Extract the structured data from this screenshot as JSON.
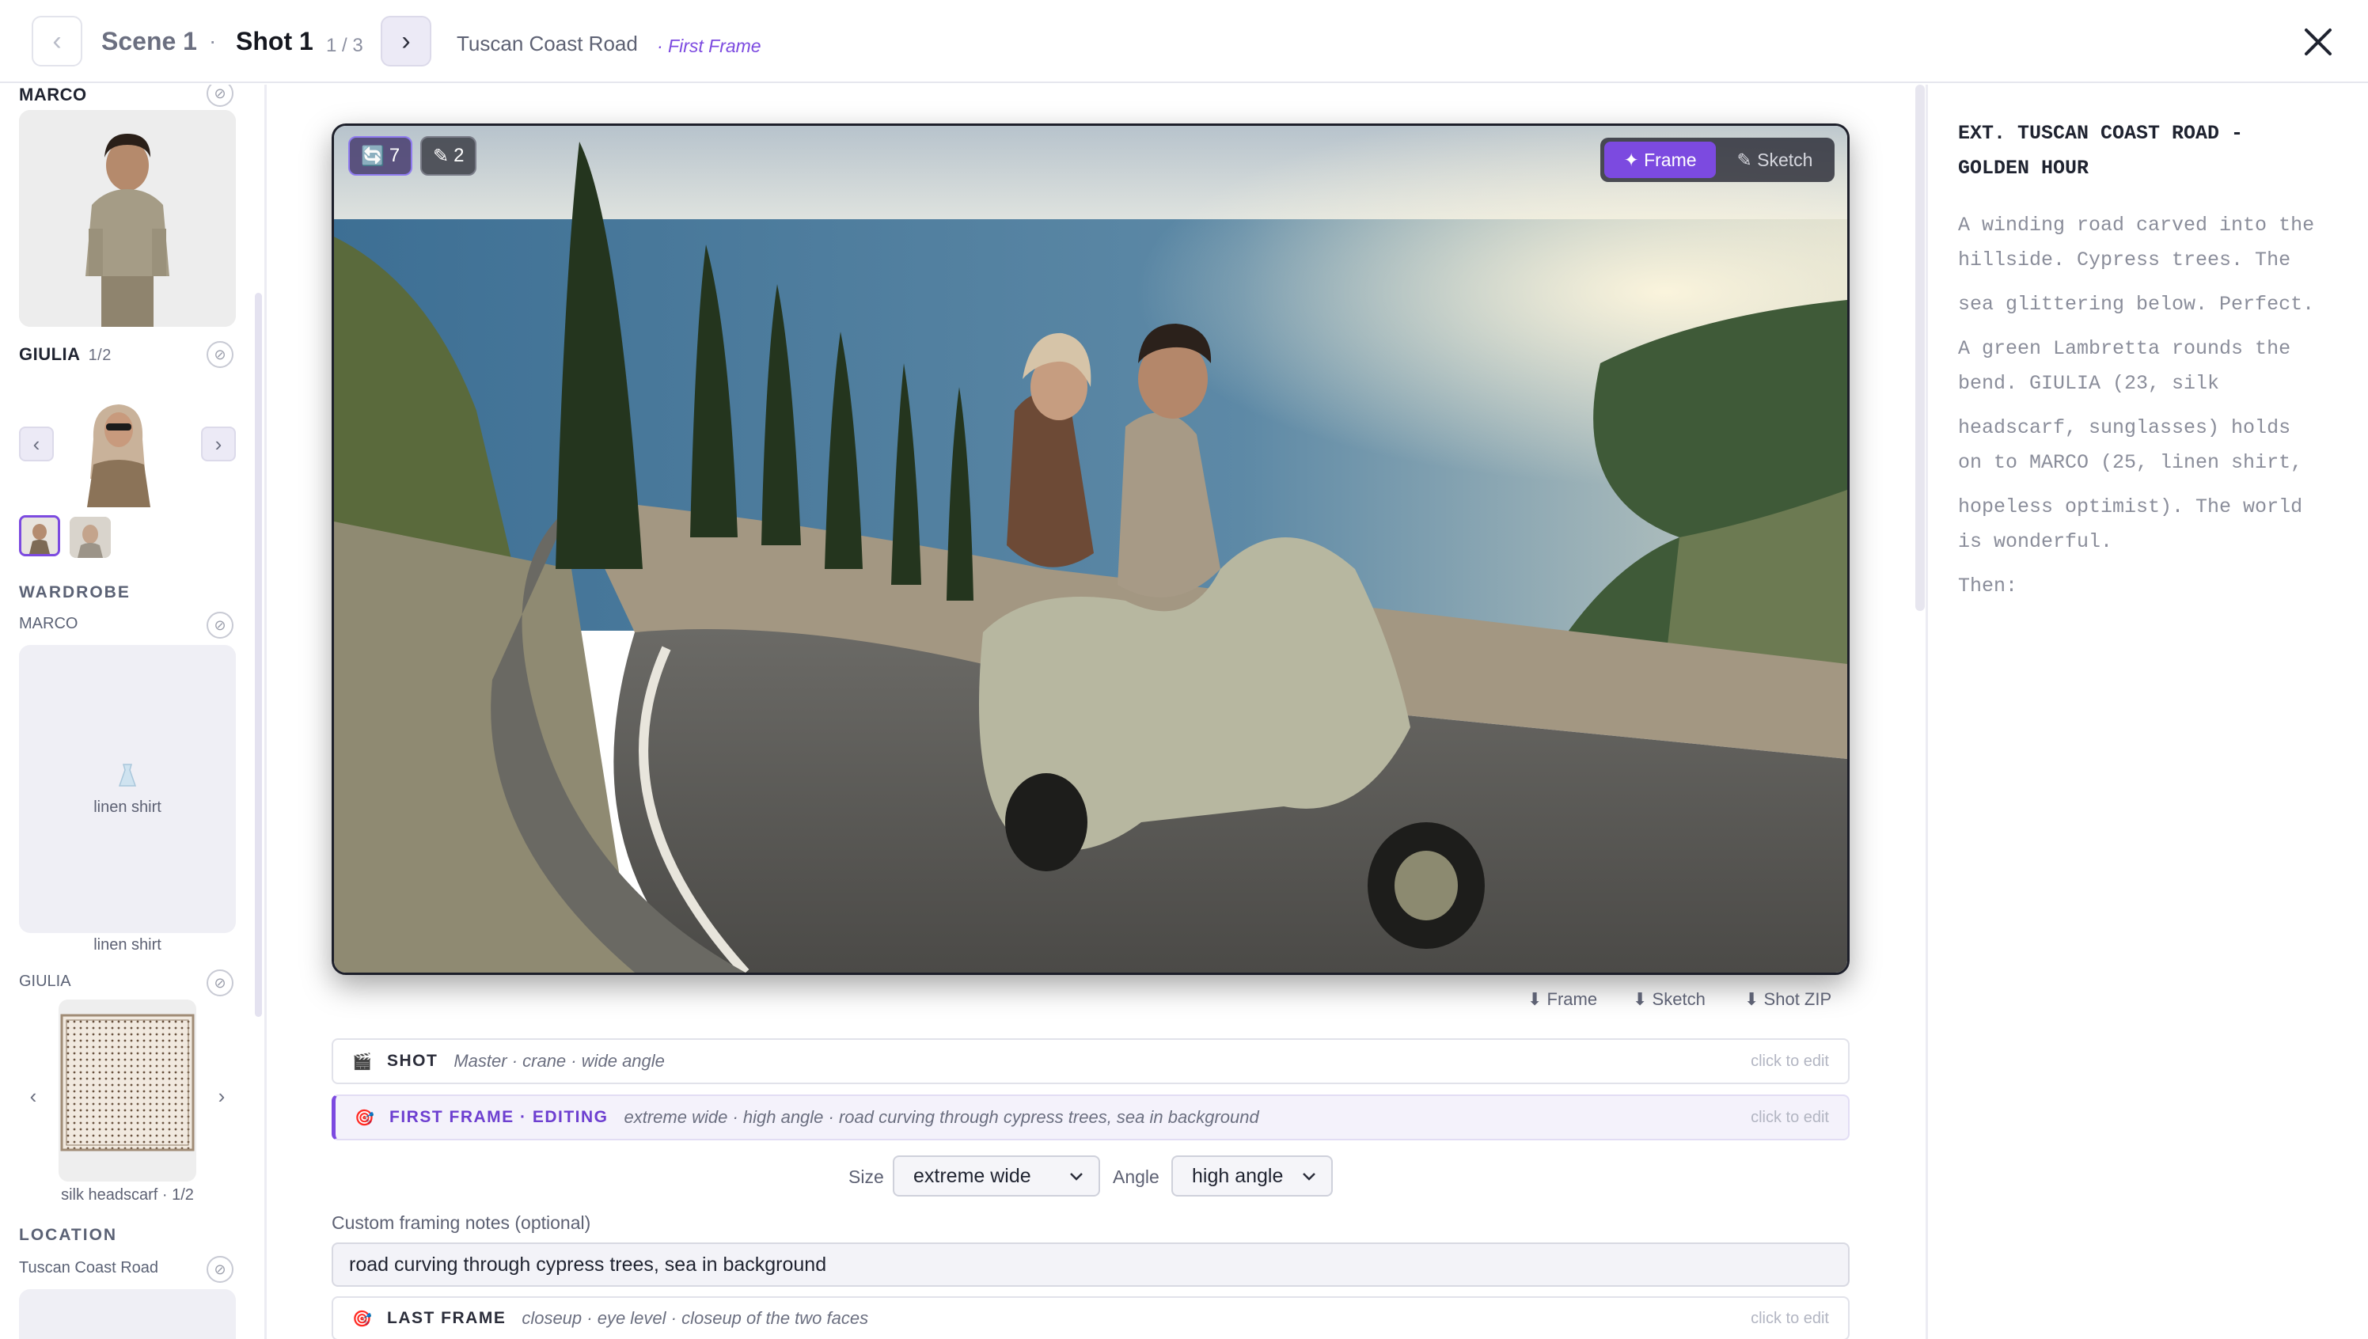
{
  "header": {
    "prev_glyph": "‹",
    "next_glyph": "›",
    "scene": "Scene 1",
    "separator": "·",
    "shot": "Shot 1",
    "shot_count": "1 / 3",
    "location": "Tuscan Coast Road",
    "frame_label": "· First Frame",
    "close_icon": "close-icon"
  },
  "sidebar": {
    "characters": [
      {
        "name": "MARCO",
        "pager": ""
      },
      {
        "name": "GIULIA",
        "pager": "1/2"
      }
    ],
    "chev_left": "‹",
    "chev_right": "›",
    "clear_glyph": "⊘",
    "wardrobe_title": "WARDROBE",
    "wardrobe": [
      {
        "owner": "MARCO",
        "item": "linen shirt",
        "caption": "linen shirt"
      },
      {
        "owner": "GIULIA",
        "caption": "silk headscarf · 1/2"
      }
    ],
    "location_title": "LOCATION",
    "location_name": "Tuscan Coast Road"
  },
  "canvas": {
    "badges": [
      {
        "icon": "refresh-icon",
        "glyph": "🔄",
        "count": "7"
      },
      {
        "icon": "pencil-icon",
        "glyph": "✎",
        "count": "2"
      }
    ],
    "mode_options": [
      {
        "label": "✦ Frame",
        "active": true
      },
      {
        "label": "✎ Sketch",
        "active": false
      }
    ],
    "downloads": [
      "⬇ Frame",
      "⬇ Sketch",
      "⬇ Shot ZIP"
    ]
  },
  "rows": {
    "shot": {
      "icon": "🎬",
      "tag": "SHOT",
      "desc": "Master · crane · wide angle",
      "hint": "click to edit"
    },
    "first_frame": {
      "icon": "🎯",
      "tag": "FIRST FRAME · EDITING",
      "desc": "extreme wide · high angle · road curving through cypress trees, sea in background",
      "hint": "click to edit"
    },
    "last_frame": {
      "icon": "🎯",
      "tag": "LAST FRAME",
      "desc": "closeup · eye level · closeup of the two faces",
      "hint": "click to edit"
    }
  },
  "framing": {
    "size_label": "Size",
    "size_value": "extreme wide",
    "angle_label": "Angle",
    "angle_value": "high angle",
    "notes_label": "Custom framing notes (optional)",
    "notes_value": "road curving through cypress trees, sea in background"
  },
  "script": {
    "heading_lines": [
      "EXT. TUSCAN COAST ROAD -",
      "GOLDEN HOUR"
    ],
    "body_lines": [
      "A winding road carved into the",
      "hillside. Cypress trees. The",
      "sea glittering below. Perfect.",
      "A green Lambretta rounds the",
      "bend. GIULIA (23, silk",
      "headscarf, sunglasses) holds",
      "on to MARCO (25, linen shirt,",
      "hopeless optimist). The world",
      "is wonderful.",
      "Then:"
    ]
  },
  "colors": {
    "accent": "#7c4ae0",
    "active_row_bg": "#f4f2fb",
    "panel_bg": "#efeff5"
  }
}
